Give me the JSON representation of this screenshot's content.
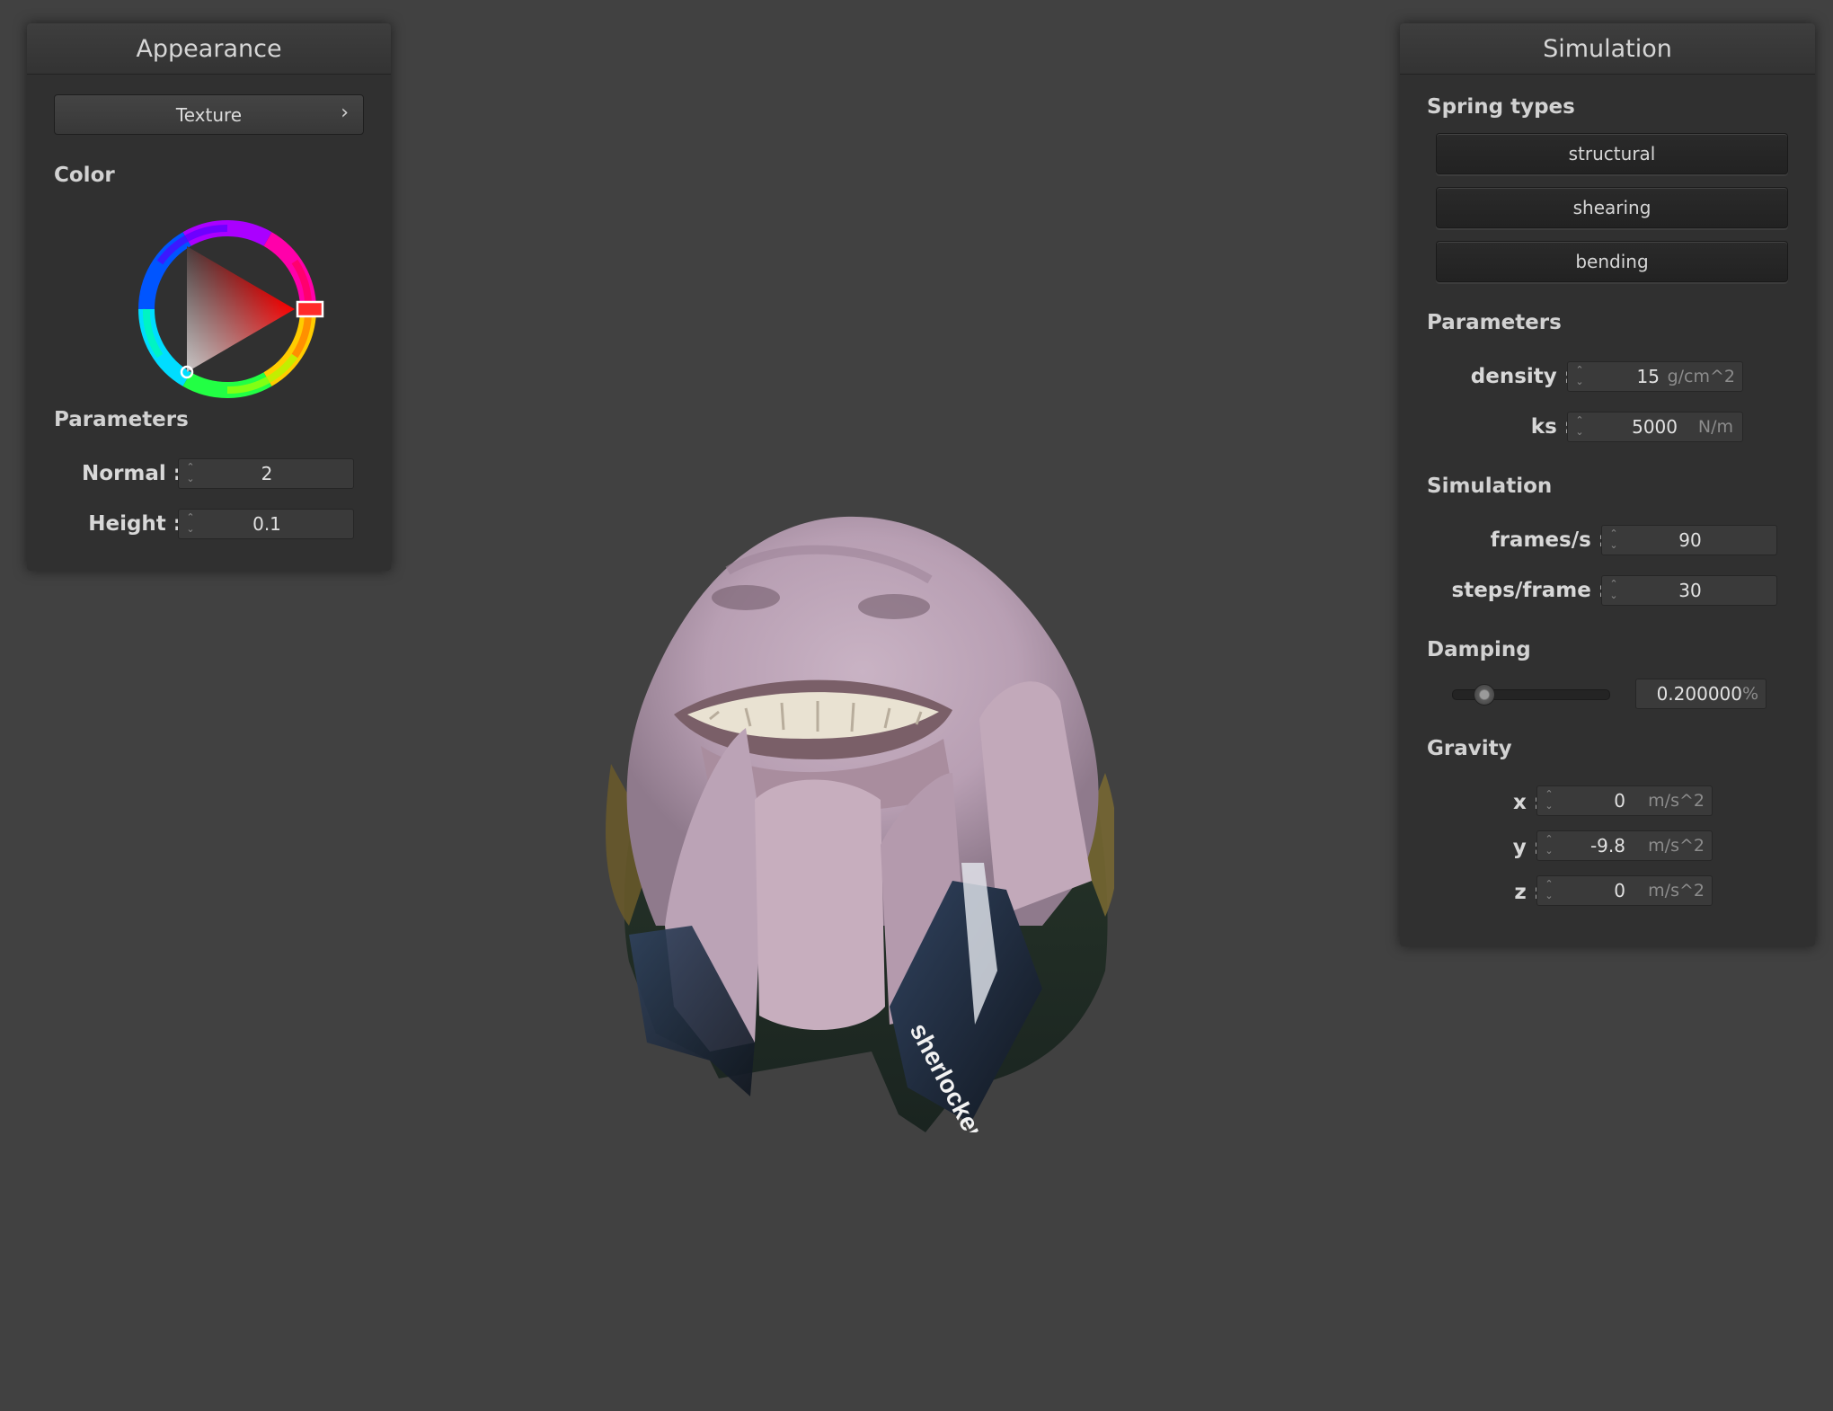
{
  "appearance": {
    "title": "Appearance",
    "texture_button": "Texture",
    "texture_chevron": "›",
    "color_label": "Color",
    "color": "#ff0000",
    "parameters_label": "Parameters",
    "normal_label": "Normal :",
    "normal_value": "2",
    "height_label": "Height :",
    "height_value": "0.1"
  },
  "simulation_panel": {
    "title": "Simulation",
    "spring_types_label": "Spring types",
    "spring_buttons": [
      "structural",
      "shearing",
      "bending"
    ],
    "parameters_label": "Parameters",
    "density_label": "density :",
    "density_value": "15",
    "density_unit": "g/cm^2",
    "ks_label": "ks :",
    "ks_value": "5000",
    "ks_unit": "N/m",
    "simulation_label": "Simulation",
    "fps_label": "frames/s :",
    "fps_value": "90",
    "steps_label": "steps/frame :",
    "steps_value": "30",
    "damping_label": "Damping",
    "damping_fraction": 0.2,
    "damping_value": "0.200000",
    "damping_unit": "%",
    "gravity_label": "Gravity",
    "gx_label": "x :",
    "gx_value": "0",
    "gy_label": "y :",
    "gy_value": "-9.8",
    "gz_label": "z :",
    "gz_value": "0",
    "gravity_unit": "m/s^2"
  },
  "scene": {
    "cloth_text": "sherlocker"
  },
  "icons": {
    "spin": "spin-arrows-icon",
    "chevron": "chevron-right-icon"
  }
}
